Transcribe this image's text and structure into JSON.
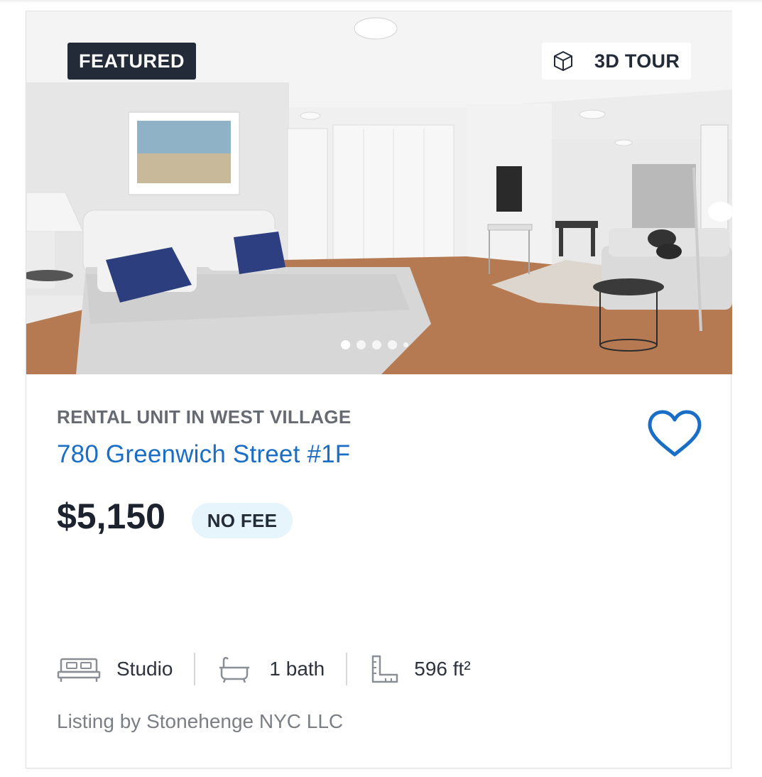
{
  "listing": {
    "featured_badge": "FEATURED",
    "tour_badge": "3D TOUR",
    "photo_slides_active": 1,
    "photo_slides_count": 5,
    "subtitle": "RENTAL UNIT IN WEST VILLAGE",
    "address": "780 Greenwich Street #1F",
    "price": "$5,150",
    "fee_badge": "NO FEE",
    "specs": {
      "rooms": "Studio",
      "baths": "1 bath",
      "size": "596 ft²"
    },
    "lister": "Listing by Stonehenge NYC LLC"
  },
  "icons": {
    "tour": "cube-icon",
    "favorite": "heart-icon",
    "rooms": "bed-icon",
    "baths": "bathtub-icon",
    "size": "ruler-icon"
  },
  "colors": {
    "accent": "#1a6ec6",
    "featured_badge_bg": "#242b38",
    "fee_badge_bg": "#e6f4fc",
    "text_dark": "#1c232f",
    "text_muted": "#666b73"
  }
}
